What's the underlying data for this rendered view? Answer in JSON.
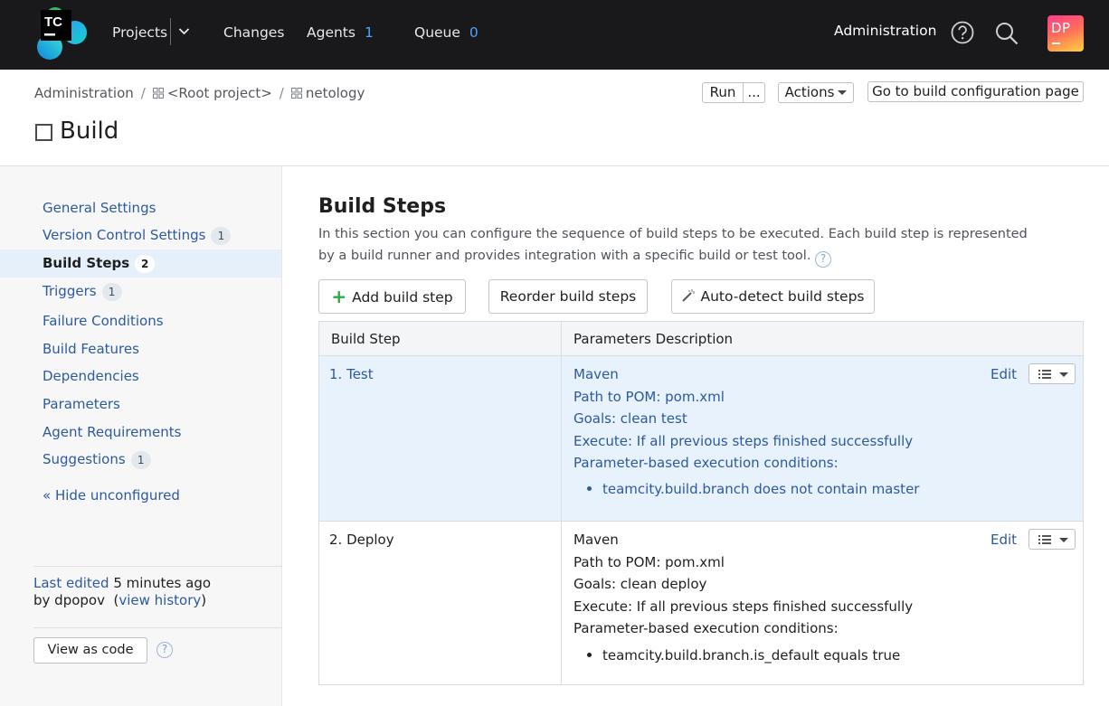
{
  "topnav": {
    "logo_text": "TC",
    "projects": "Projects",
    "changes": "Changes",
    "agents": "Agents",
    "agents_count": "1",
    "queue": "Queue",
    "queue_count": "0",
    "administration": "Administration",
    "avatar_initials": "DP"
  },
  "breadcrumb": {
    "items": [
      "Administration",
      "<Root project>",
      "netology"
    ],
    "separator": "/"
  },
  "page": {
    "title": "Build",
    "run_label": "Run",
    "run_more_label": "...",
    "actions_label": "Actions",
    "goto_label": "Go to build configuration page"
  },
  "sidebar": {
    "items": [
      {
        "label": "General Settings",
        "badge": ""
      },
      {
        "label": "Version Control Settings",
        "badge": "1"
      },
      {
        "label": "Build Steps",
        "badge": "2"
      },
      {
        "label": "Triggers",
        "badge": "1"
      },
      {
        "label": "Failure Conditions",
        "badge": ""
      },
      {
        "label": "Build Features",
        "badge": ""
      },
      {
        "label": "Dependencies",
        "badge": ""
      },
      {
        "label": "Parameters",
        "badge": ""
      },
      {
        "label": "Agent Requirements",
        "badge": ""
      },
      {
        "label": "Suggestions",
        "badge": "1"
      }
    ],
    "hide_unconfigured": "« Hide unconfigured",
    "last_edited_link": "Last edited",
    "last_edited_time": "5 minutes ago",
    "by_prefix": "by dpopov",
    "view_history": "view history",
    "view_as_code": "View as code"
  },
  "main": {
    "title": "Build Steps",
    "description": "In this section you can configure the sequence of build steps to be executed. Each build step is represented by a build runner and provides integration with a specific build or test tool.",
    "add_step": "Add build step",
    "reorder_steps": "Reorder build steps",
    "auto_detect": "Auto-detect build steps",
    "columns": [
      "Build Step",
      "Parameters Description"
    ],
    "steps": [
      {
        "name": "1. Test",
        "runner": "Maven",
        "pom": "Path to POM: pom.xml",
        "goals": "Goals: clean test",
        "execute": "Execute: If all previous steps finished successfully",
        "conditions_label": "Parameter-based execution conditions:",
        "condition": "teamcity.build.branch does not contain master",
        "edit": "Edit"
      },
      {
        "name": "2. Deploy",
        "runner": "Maven",
        "pom": "Path to POM: pom.xml",
        "goals": "Goals: clean deploy",
        "execute": "Execute: If all previous steps finished successfully",
        "conditions_label": "Parameter-based execution conditions:",
        "condition": "teamcity.build.branch.is_default equals true",
        "edit": "Edit"
      }
    ]
  },
  "colors": {
    "topbar": "#19191c",
    "link": "#2c5aa0",
    "badge_blue": "#4aa3ff",
    "selected_row": "#e8f2fc",
    "add_plus": "#2ea84b"
  }
}
